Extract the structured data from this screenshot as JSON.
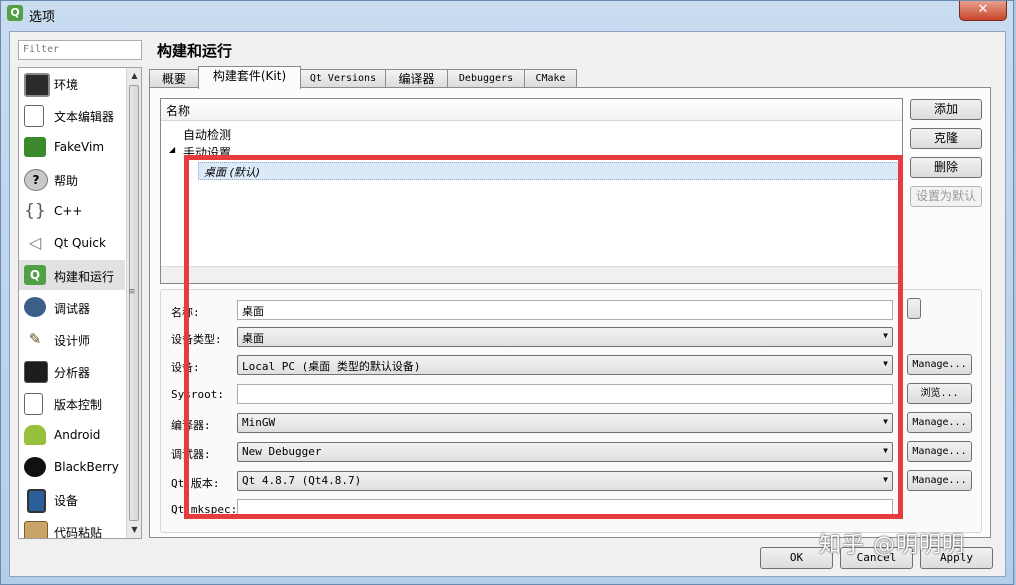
{
  "window": {
    "title": "选项",
    "app_icon": "Q",
    "close_label": "✕"
  },
  "filter": {
    "placeholder": "Filter"
  },
  "nav": {
    "items": [
      {
        "label": "环境",
        "icon": "monitor-icon"
      },
      {
        "label": "文本编辑器",
        "icon": "document-icon"
      },
      {
        "label": "FakeVim",
        "icon": "fakevim-icon"
      },
      {
        "label": "帮助",
        "icon": "help-icon"
      },
      {
        "label": "C++",
        "icon": "braces-icon"
      },
      {
        "label": "Qt Quick",
        "icon": "paper-plane-icon"
      },
      {
        "label": "构建和运行",
        "icon": "build-run-icon",
        "selected": true
      },
      {
        "label": "调试器",
        "icon": "debugger-icon"
      },
      {
        "label": "设计师",
        "icon": "designer-icon"
      },
      {
        "label": "分析器",
        "icon": "analyzer-icon"
      },
      {
        "label": "版本控制",
        "icon": "version-control-icon"
      },
      {
        "label": "Android",
        "icon": "android-icon"
      },
      {
        "label": "BlackBerry",
        "icon": "blackberry-icon"
      },
      {
        "label": "设备",
        "icon": "device-icon"
      },
      {
        "label": "代码粘贴",
        "icon": "clipboard-icon"
      }
    ]
  },
  "main": {
    "title": "构建和运行",
    "tabs": [
      {
        "label": "概要"
      },
      {
        "label": "构建套件(Kit)",
        "active": true
      },
      {
        "label": "Qt Versions"
      },
      {
        "label": "编译器"
      },
      {
        "label": "Debuggers"
      },
      {
        "label": "CMake"
      }
    ],
    "tree": {
      "header": "名称",
      "auto_detect": "自动检测",
      "manual": "手动设置",
      "kit": "桌面 (默认)"
    },
    "buttons": {
      "add": "添加",
      "clone": "克隆",
      "remove": "删除",
      "make_default": "设置为默认"
    },
    "form": {
      "name_label": "名称:",
      "name_value": "桌面",
      "device_type_label": "设备类型:",
      "device_type_value": "桌面",
      "device_label": "设备:",
      "device_value": "Local PC (桌面 类型的默认设备)",
      "sysroot_label": "Sysroot:",
      "sysroot_value": "",
      "compiler_label": "编译器:",
      "compiler_value": "MinGW",
      "debugger_label": "调试器:",
      "debugger_value": "New Debugger",
      "qt_version_label": "Qt 版本:",
      "qt_version_value": "Qt 4.8.7 (Qt4.8.7)",
      "mkspec_label": "Qt mkspec:",
      "mkspec_value": "",
      "manage": "Manage...",
      "browse": "浏览..."
    }
  },
  "dialog_buttons": {
    "ok": "OK",
    "cancel": "Cancel",
    "apply": "Apply"
  },
  "watermark": "知乎 @明明明",
  "colors": {
    "highlight_box": "#e83b3f"
  }
}
